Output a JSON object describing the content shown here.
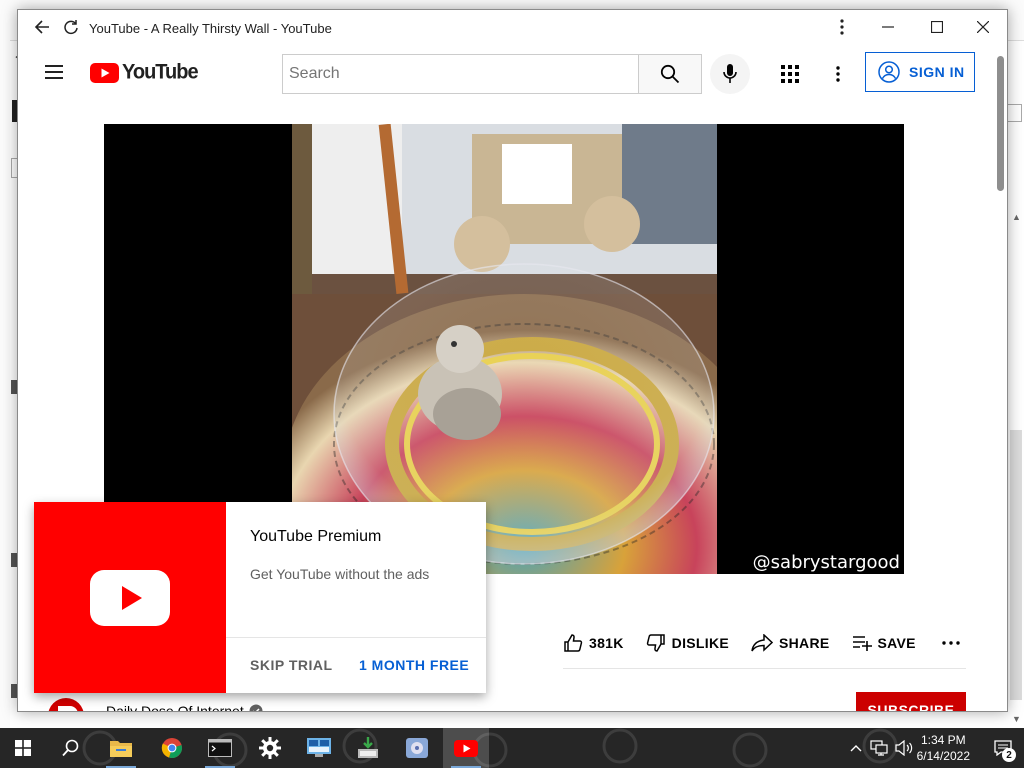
{
  "window": {
    "title": "YouTube - A Really Thirsty Wall - YouTube"
  },
  "header": {
    "logo_text": "YouTube",
    "search_placeholder": "Search",
    "signin_label": "SIGN IN"
  },
  "video": {
    "watermark": "@sabrystargood"
  },
  "actions": {
    "like_count": "381K",
    "dislike_label": "DISLIKE",
    "share_label": "SHARE",
    "save_label": "SAVE"
  },
  "channel": {
    "name": "Daily Dose Of Internet",
    "subscribe_label": "SUBSCRIBE"
  },
  "promo": {
    "title": "YouTube Premium",
    "description": "Get YouTube without the ads",
    "skip_label": "SKIP TRIAL",
    "trial_label": "1 MONTH FREE"
  },
  "taskbar": {
    "time": "1:34 PM",
    "date": "6/14/2022",
    "notification_count": "2",
    "items": [
      "start-icon",
      "search-icon",
      "file-explorer-icon",
      "chrome-icon",
      "terminal-icon",
      "settings-icon",
      "network-app-icon",
      "installer-icon",
      "media-app-icon",
      "youtube-app-icon"
    ]
  },
  "colors": {
    "brand_red": "#ff0000",
    "link_blue": "#065fd4",
    "subscribe_red": "#cc0000"
  }
}
